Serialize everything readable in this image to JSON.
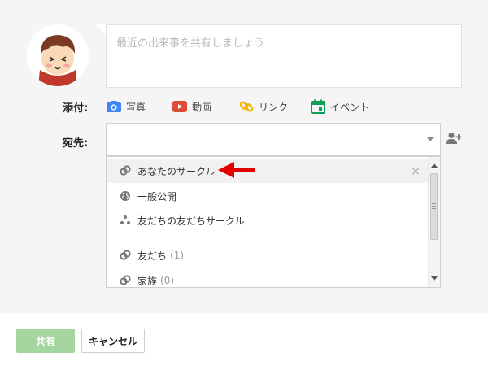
{
  "post": {
    "placeholder": "最近の出来事を共有しましょう"
  },
  "attach": {
    "label": "添付:",
    "items": [
      {
        "label": "写真",
        "icon": "camera-icon",
        "color": "#4285f4"
      },
      {
        "label": "動画",
        "icon": "youtube-icon",
        "color": "#dd4b39"
      },
      {
        "label": "リンク",
        "icon": "link-icon",
        "color": "#f4b400"
      },
      {
        "label": "イベント",
        "icon": "calendar-icon",
        "color": "#0f9d58"
      }
    ]
  },
  "recipients": {
    "label": "宛先:",
    "options": [
      {
        "label": "あなたのサークル",
        "icon": "circle-link-icon",
        "count": ""
      },
      {
        "label": "一般公開",
        "icon": "globe-icon",
        "count": ""
      },
      {
        "label": "友だちの友だちサークル",
        "icon": "extended-circles-icon",
        "count": ""
      },
      {
        "label": "友だち",
        "icon": "circle-link-icon",
        "count": "(1)"
      },
      {
        "label": "家族",
        "icon": "circle-link-icon",
        "count": "(0)"
      }
    ],
    "close_symbol": "×"
  },
  "actions": {
    "share_label": "共有",
    "cancel_label": "キャンセル"
  },
  "colors": {
    "accent_red": "#e00000",
    "share_green": "#a6d6a0"
  }
}
